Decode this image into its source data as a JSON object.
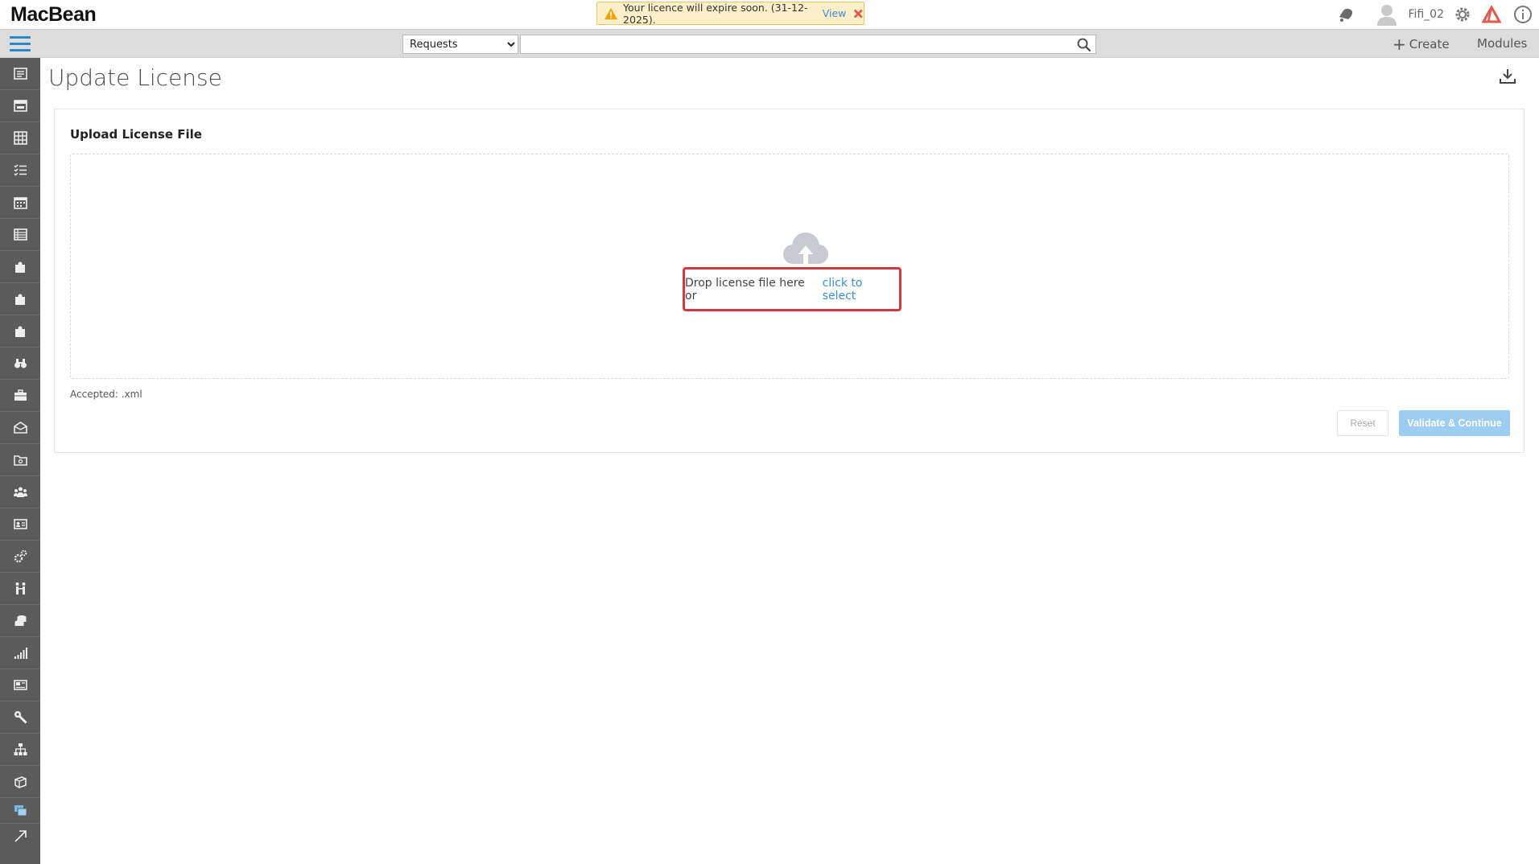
{
  "app": {
    "logo": "MacBean"
  },
  "banner": {
    "message": "Your licence will expire soon. (31-12-2025).",
    "view_link": "View",
    "warning_color": "#f0a30a",
    "close_color": "#e05a4f"
  },
  "header": {
    "username": "Fifi_02",
    "icons": [
      "bell-icon",
      "user-avatar-icon",
      "settings-gear-icon",
      "brand-triangle-icon",
      "info-icon"
    ]
  },
  "toolbar": {
    "search_scope": "Requests",
    "search_scope_options": [
      "Requests"
    ],
    "search_value": "",
    "create_label": "Create",
    "modules_label": "Modules",
    "accent_color": "#2f86c9"
  },
  "sidebar": {
    "items": [
      "dashboard-icon",
      "calendar-view-icon",
      "grid-icon",
      "checklist-icon",
      "calendar-icon",
      "list-icon",
      "puzzle-icon",
      "puzzle-alt-icon",
      "puzzle-third-icon",
      "binoculars-icon",
      "briefcase-icon",
      "inbox-icon",
      "folder-icon",
      "team-icon",
      "contact-card-icon",
      "gears-icon",
      "people-icon",
      "database-icon",
      "stats-icon",
      "news-icon",
      "wrench-icon",
      "hierarchy-icon",
      "box-icon",
      "windows-icon",
      "expand-arrow-icon"
    ]
  },
  "page": {
    "title": "Update License",
    "panel_title": "Upload License File",
    "drop_text": "Drop license file here or",
    "drop_link": "click to select",
    "accepted_text": "Accepted: .xml",
    "reset_label": "Reset",
    "validate_label": "Validate & Continue",
    "link_color": "#3a8ed0",
    "highlight_color": "#d23b3b"
  }
}
